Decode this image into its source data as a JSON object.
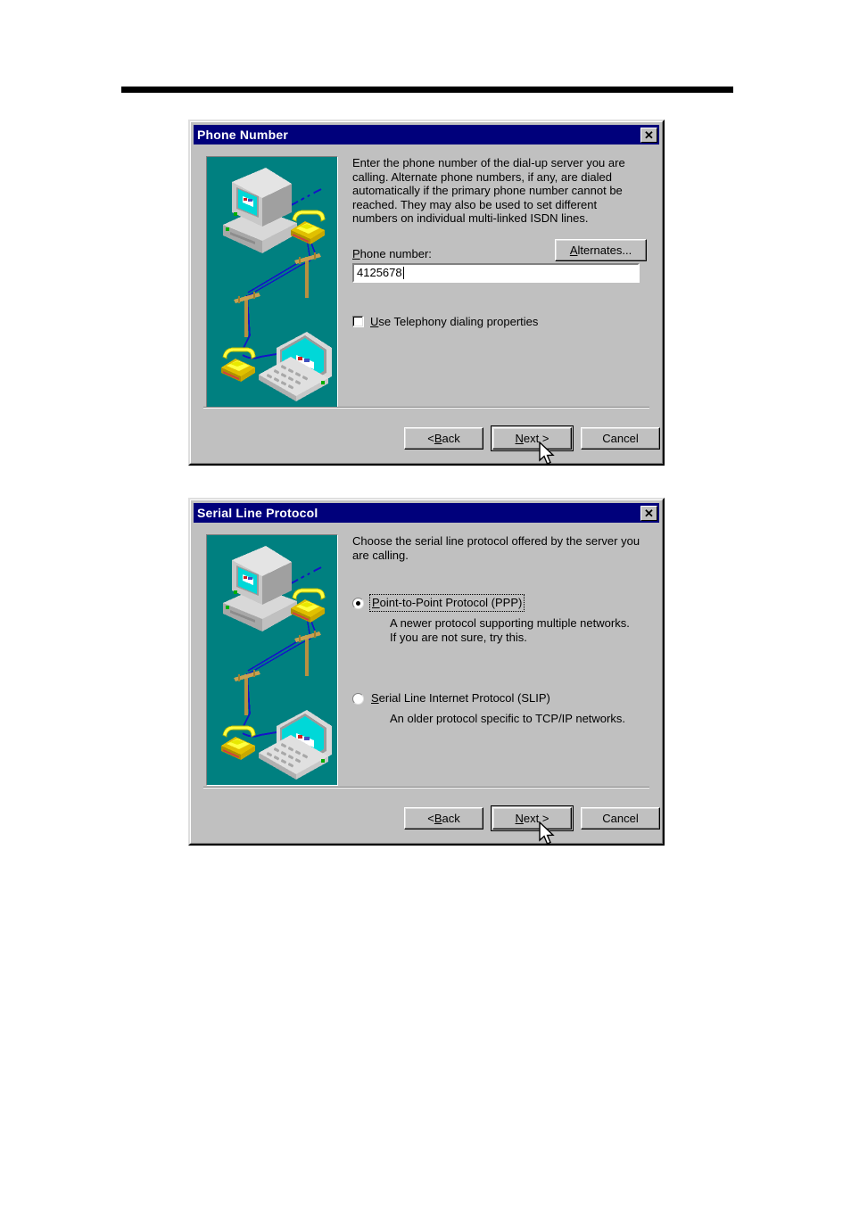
{
  "page": {
    "rule": "horizontal-rule"
  },
  "dialogs": [
    {
      "id": "phone-number",
      "title": "Phone Number",
      "close_label": "✕",
      "body_text": "Enter the phone number of the dial-up server you are\ncalling.   Alternate phone numbers, if any, are dialed\nautomatically if the primary phone number cannot be\nreached.  They may also be used to set different\nnumbers on individual multi-linked ISDN lines.",
      "field": {
        "label_underlined": "P",
        "label_rest": "hone number:",
        "value": "4125678",
        "placeholder": ""
      },
      "alternates_button": {
        "underlined": "A",
        "rest": "lternates..."
      },
      "checkbox": {
        "checked": false,
        "label_underlined": "U",
        "label_rest": "se Telephony dialing properties"
      },
      "buttons": {
        "back_prefix": "< ",
        "back_underlined": "B",
        "back_rest": "ack",
        "next_underlined": "N",
        "next_rest": "ext >",
        "cancel": "Cancel",
        "default": "next"
      }
    },
    {
      "id": "serial-line-protocol",
      "title": "Serial Line Protocol",
      "close_label": "✕",
      "body_text": "Choose the serial line protocol offered by the server you\nare calling.",
      "options": [
        {
          "selected": true,
          "focused": true,
          "label_underlined": "P",
          "label_rest": "oint-to-Point Protocol (PPP)",
          "description": "A newer protocol supporting multiple networks.\nIf you are not sure, try this."
        },
        {
          "selected": false,
          "focused": false,
          "label_underlined": "S",
          "label_rest": "erial Line Internet Protocol (SLIP)",
          "description": "An older protocol specific to TCP/IP networks."
        }
      ],
      "buttons": {
        "back_prefix": "< ",
        "back_underlined": "B",
        "back_rest": "ack",
        "next_underlined": "N",
        "next_rest": "ext >",
        "cancel": "Cancel",
        "default": "next"
      }
    }
  ],
  "colors": {
    "titlebar": "#00007b",
    "dialog_face": "#c0c0c0",
    "illustration_background": "#008080",
    "phone_yellow": "#ffff00",
    "screen_cyan": "#00ffff",
    "wire_blue": "#0000cd",
    "pole_tan": "#c8a050"
  },
  "illustration": {
    "name": "dialup-network-illustration",
    "elements": [
      "desktop-computer",
      "telephone-top",
      "utility-pole-right",
      "utility-pole-left",
      "telephone-bottom",
      "laptop-computer",
      "phone-wires"
    ]
  },
  "cursor": {
    "name": "arrow-pointer"
  }
}
